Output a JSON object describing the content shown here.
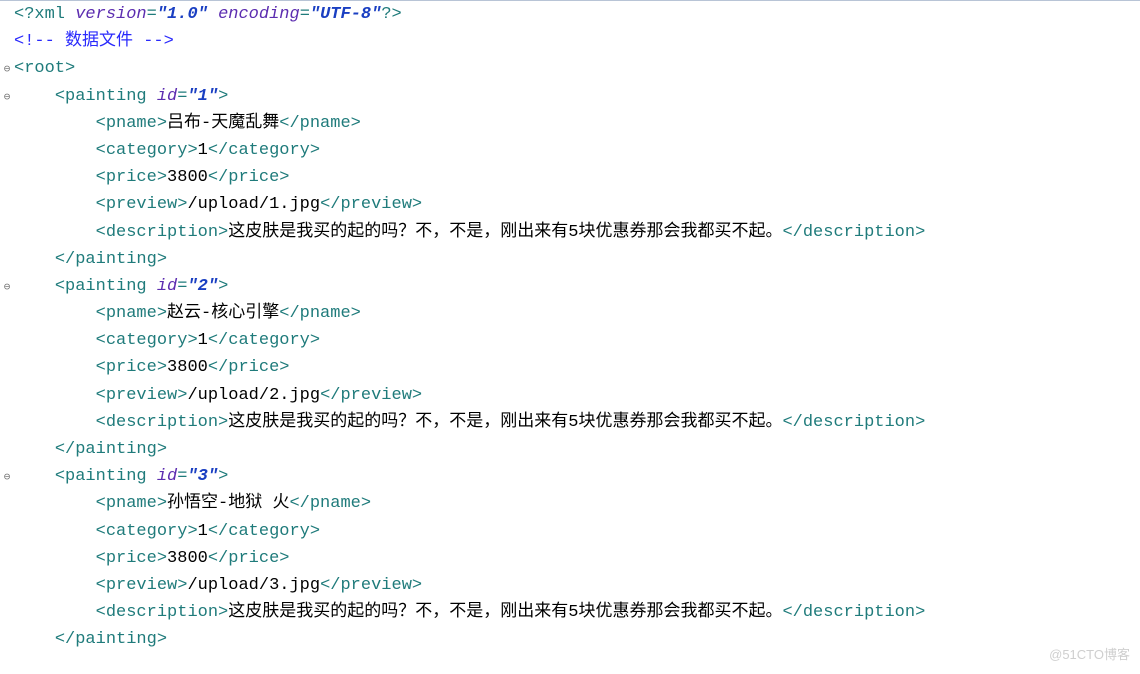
{
  "xmlDecl": {
    "open": "<?",
    "name": "xml",
    "attrs": [
      [
        "version",
        "1.0"
      ],
      [
        "encoding",
        "UTF-8"
      ]
    ],
    "close": "?>"
  },
  "comment": "<!-- 数据文件 -->",
  "rootOpen": "<root>",
  "foldCollapse": "⊖",
  "rootIndent": "",
  "p1": {
    "open": {
      "t": "painting",
      "attrs": [
        [
          "id",
          "1"
        ]
      ]
    },
    "pname": "吕布-天魔乱舞",
    "category": "1",
    "price": "3800",
    "preview": "/upload/1.jpg",
    "description": "这皮肤是我买的起的吗？不，不是，刚出来有5块优惠券那会我都买不起。"
  },
  "p2": {
    "open": {
      "t": "painting",
      "attrs": [
        [
          "id",
          "2"
        ]
      ]
    },
    "pname": "赵云-核心引擎",
    "category": "1",
    "price": "3800",
    "preview": "/upload/2.jpg",
    "description": "这皮肤是我买的起的吗？不，不是，刚出来有5块优惠券那会我都买不起。"
  },
  "p3": {
    "open": {
      "t": "painting",
      "attrs": [
        [
          "id",
          "3"
        ]
      ]
    },
    "pname": "孙悟空-地狱 火",
    "category": "1",
    "price": "3800",
    "preview": "/upload/3.jpg",
    "description": "这皮肤是我买的起的吗？不，不是，刚出来有5块优惠券那会我都买不起。"
  },
  "tags": {
    "pname": "pname",
    "category": "category",
    "price": "price",
    "preview": "preview",
    "description": "description",
    "painting": "painting"
  },
  "indent1": "    ",
  "indent2": "        ",
  "watermark": "@51CTO博客"
}
